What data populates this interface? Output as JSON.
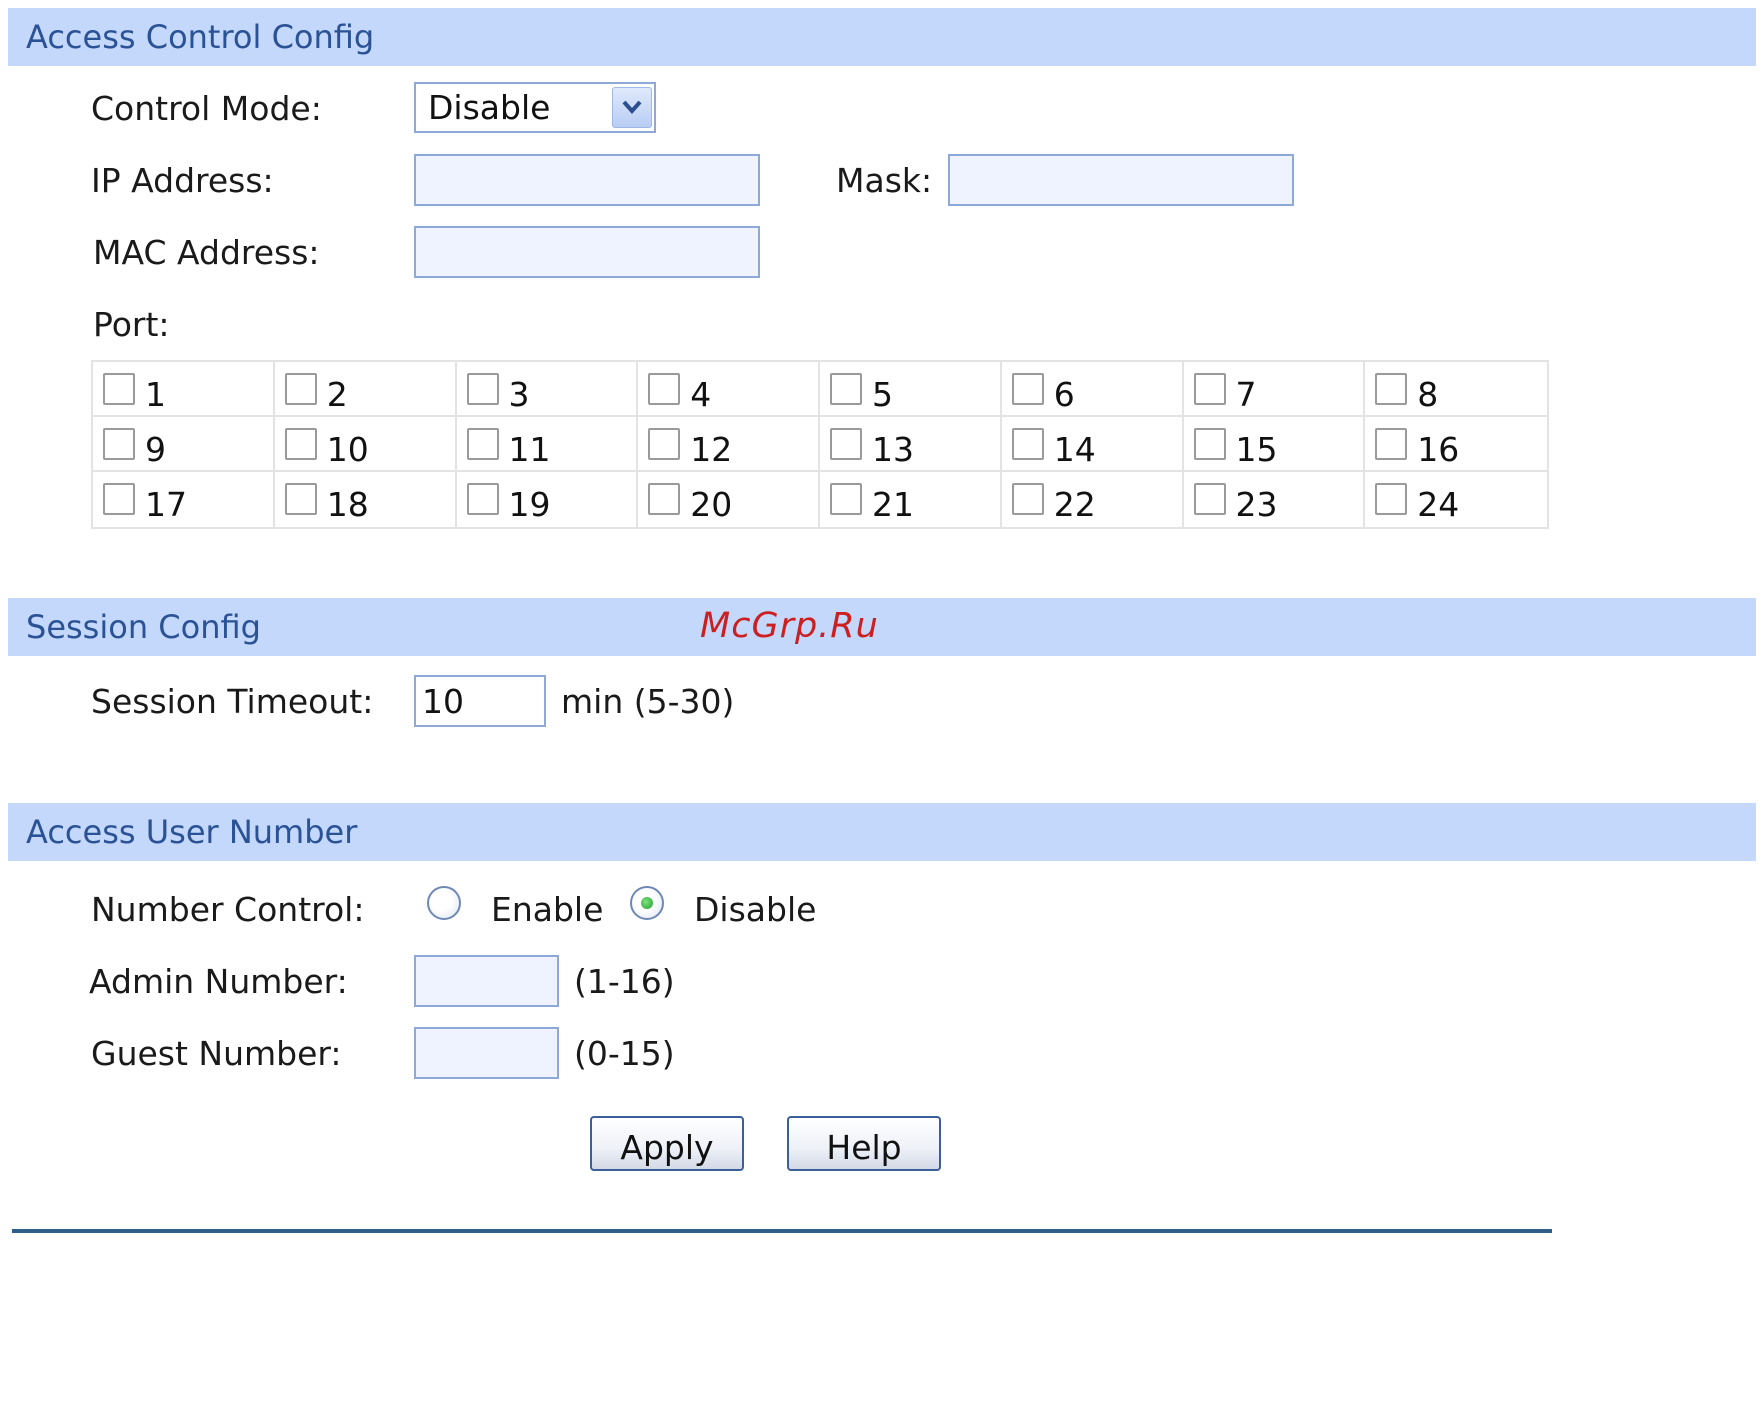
{
  "access_control": {
    "title": "Access Control Config",
    "control_mode_label": "Control Mode:",
    "control_mode_value": "Disable",
    "ip_label": "IP Address:",
    "ip_value": "",
    "mask_label": "Mask:",
    "mask_value": "",
    "mac_label": "MAC Address:",
    "mac_value": "",
    "port_label": "Port:",
    "ports": [
      {
        "label": "1",
        "checked": false
      },
      {
        "label": "2",
        "checked": false
      },
      {
        "label": "3",
        "checked": false
      },
      {
        "label": "4",
        "checked": false
      },
      {
        "label": "5",
        "checked": false
      },
      {
        "label": "6",
        "checked": false
      },
      {
        "label": "7",
        "checked": false
      },
      {
        "label": "8",
        "checked": false
      },
      {
        "label": "9",
        "checked": false
      },
      {
        "label": "10",
        "checked": false
      },
      {
        "label": "11",
        "checked": false
      },
      {
        "label": "12",
        "checked": false
      },
      {
        "label": "13",
        "checked": false
      },
      {
        "label": "14",
        "checked": false
      },
      {
        "label": "15",
        "checked": false
      },
      {
        "label": "16",
        "checked": false
      },
      {
        "label": "17",
        "checked": false
      },
      {
        "label": "18",
        "checked": false
      },
      {
        "label": "19",
        "checked": false
      },
      {
        "label": "20",
        "checked": false
      },
      {
        "label": "21",
        "checked": false
      },
      {
        "label": "22",
        "checked": false
      },
      {
        "label": "23",
        "checked": false
      },
      {
        "label": "24",
        "checked": false
      }
    ]
  },
  "session": {
    "title": "Session Config",
    "timeout_label": "Session Timeout:",
    "timeout_value": "10",
    "timeout_unit": "min (5-30)"
  },
  "user_number": {
    "title": "Access User Number",
    "number_control_label": "Number Control:",
    "enable_label": "Enable",
    "disable_label": "Disable",
    "selected": "disable",
    "admin_label": "Admin Number:",
    "admin_value": "",
    "admin_range": "(1-16)",
    "guest_label": "Guest Number:",
    "guest_value": "",
    "guest_range": "(0-15)"
  },
  "buttons": {
    "apply": "Apply",
    "help": "Help"
  },
  "watermark": "McGrp.Ru",
  "icons": {
    "dropdown": "chevron-down-icon"
  },
  "colors": {
    "header_bg": "#c4d8fc",
    "header_text": "#2a5295",
    "watermark": "#cc1f1f"
  }
}
